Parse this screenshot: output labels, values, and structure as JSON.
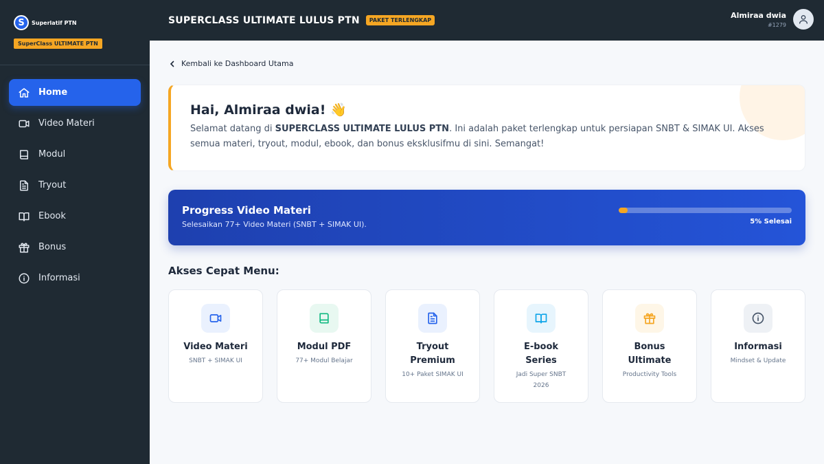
{
  "brand": {
    "logo_letter": "S",
    "name": "Superlatif PTN",
    "badge": "SuperClass ULTIMATE PTN"
  },
  "sidebar": {
    "items": [
      {
        "label": "Home",
        "icon": "home-icon",
        "active": true
      },
      {
        "label": "Video Materi",
        "icon": "video-icon"
      },
      {
        "label": "Modul",
        "icon": "book-icon"
      },
      {
        "label": "Tryout",
        "icon": "file-text-icon"
      },
      {
        "label": "Ebook",
        "icon": "open-book-icon"
      },
      {
        "label": "Bonus",
        "icon": "gift-icon"
      },
      {
        "label": "Informasi",
        "icon": "info-icon"
      }
    ]
  },
  "header": {
    "title": "SUPERCLASS ULTIMATE LULUS PTN",
    "badge": "PAKET TERLENGKAP"
  },
  "user": {
    "name": "Almiraa dwia",
    "id": "#1279",
    "icon": "user-icon"
  },
  "back_link": "Kembali ke Dashboard Utama",
  "welcome": {
    "greeting": "Hai, Almiraa dwia! 👋",
    "text_before": "Selamat datang di ",
    "text_bold": "SUPERCLASS ULTIMATE LULUS PTN",
    "text_after": ". Ini adalah paket terlengkap untuk persiapan SNBT & SIMAK UI. Akses semua materi, tryout, modul, ebook, dan bonus eksklusifmu di sini. Semangat!"
  },
  "progress": {
    "title": "Progress Video Materi",
    "subtitle": "Selesaikan 77+ Video Materi (SNBT + SIMAK UI).",
    "percent": 5,
    "label": "5% Selesai"
  },
  "quick_menu": {
    "title": "Akses Cepat Menu:",
    "cards": [
      {
        "title": "Video Materi",
        "subtitle": "SNBT + SIMAK UI",
        "icon": "video-icon",
        "color": "#2563eb",
        "bg": "#eaf1fe"
      },
      {
        "title": "Modul PDF",
        "subtitle": "77+ Modul Belajar",
        "icon": "book-icon",
        "color": "#10b981",
        "bg": "#e8f8f1"
      },
      {
        "title": "Tryout Premium",
        "subtitle": "10+ Paket SIMAK UI",
        "icon": "file-text-icon",
        "color": "#2563eb",
        "bg": "#eaf1fe"
      },
      {
        "title": "E-book Series",
        "subtitle": "Jadi Super SNBT 2026",
        "icon": "open-book-icon",
        "color": "#0ea5e9",
        "bg": "#e7f5fd"
      },
      {
        "title": "Bonus Ultimate",
        "subtitle": "Productivity Tools",
        "icon": "gift-icon",
        "color": "#f5a623",
        "bg": "#fef6e7"
      },
      {
        "title": "Informasi",
        "subtitle": "Mindset & Update",
        "icon": "info-icon",
        "color": "#475569",
        "bg": "#eef1f5"
      }
    ]
  },
  "colors": {
    "accent": "#2563eb",
    "brand_dark": "#1f2a33",
    "highlight": "#f5a623"
  }
}
